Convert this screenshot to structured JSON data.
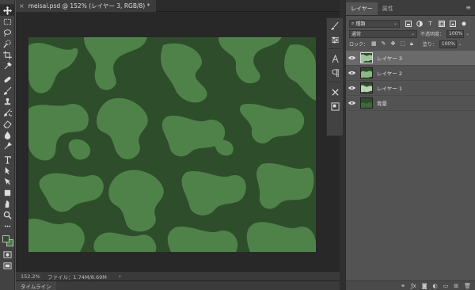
{
  "document": {
    "tab_title": "meisai.psd @ 152% (レイヤー 3, RGB/8) *",
    "close_glyph": "×"
  },
  "status": {
    "zoom": "152.2%",
    "file_info": "ファイル：1.74M/8.69M",
    "arrow": "›"
  },
  "timeline": {
    "label": "タイムライン"
  },
  "panel": {
    "tabs": [
      "レイヤー",
      "属性"
    ],
    "menu_glyph": "≡",
    "filter_kind": "種類",
    "blend_mode": "通常",
    "opacity_label": "不透明度：",
    "opacity_value": "100%",
    "lock_label": "ロック：",
    "fill_label": "塗り：",
    "fill_value": "100%"
  },
  "layers": [
    {
      "name": "レイヤー 3",
      "selected": true
    },
    {
      "name": "レイヤー 2",
      "selected": false
    },
    {
      "name": "レイヤー 1",
      "selected": false
    },
    {
      "name": "背景",
      "selected": false
    }
  ],
  "tools": [
    "move-tool",
    "marquee-tool",
    "lasso-tool",
    "quick-select-tool",
    "crop-tool",
    "eyedropper-tool",
    "healing-tool",
    "brush-tool",
    "stamp-tool",
    "history-brush-tool",
    "eraser-tool",
    "gradient-tool",
    "dodge-tool",
    "pen-tool",
    "type-tool",
    "path-select-tool",
    "rectangle-tool",
    "hand-tool",
    "zoom-tool"
  ],
  "colors": {
    "foreground": "#2f4e2b",
    "background": "#4a7a45",
    "pattern_dark": "#2e4d2a",
    "pattern_light": "#4e8249"
  }
}
